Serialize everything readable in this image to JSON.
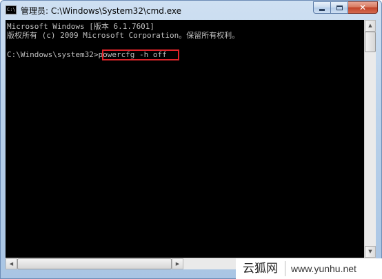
{
  "window": {
    "title": "管理员: C:\\Windows\\System32\\cmd.exe",
    "app_icon_text": "C:\\"
  },
  "caption_buttons": {
    "minimize_icon": "minimize-icon",
    "maximize_icon": "maximize-icon",
    "close_icon": "close-icon",
    "close_glyph": "✕"
  },
  "console": {
    "lines": [
      "Microsoft Windows [版本 6.1.7601]",
      "版权所有 (c) 2009 Microsoft Corporation。保留所有权利。",
      "",
      "C:\\Windows\\system32>powercfg -h off"
    ],
    "highlight_color": "#e0242a",
    "background": "#000000",
    "foreground": "#c0c0c0"
  },
  "scrollbars": {
    "up_arrow": "▲",
    "down_arrow": "▼",
    "left_arrow": "◀",
    "right_arrow": "▶"
  },
  "watermark": {
    "cn": "云狐网",
    "url": "www.yunhu.net"
  }
}
